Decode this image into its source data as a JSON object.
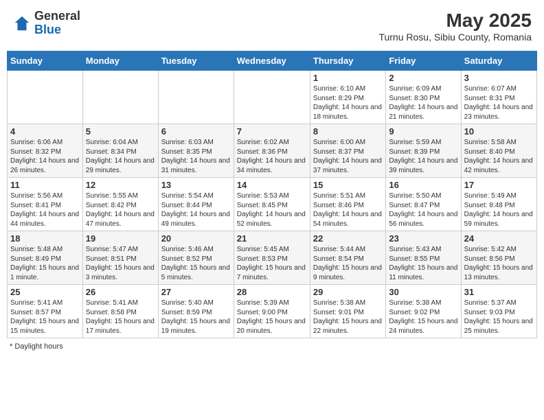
{
  "header": {
    "logo_general": "General",
    "logo_blue": "Blue",
    "title": "May 2025",
    "subtitle": "Turnu Rosu, Sibiu County, Romania"
  },
  "days_of_week": [
    "Sunday",
    "Monday",
    "Tuesday",
    "Wednesday",
    "Thursday",
    "Friday",
    "Saturday"
  ],
  "weeks": [
    [
      {
        "day": "",
        "info": ""
      },
      {
        "day": "",
        "info": ""
      },
      {
        "day": "",
        "info": ""
      },
      {
        "day": "",
        "info": ""
      },
      {
        "day": "1",
        "info": "Sunrise: 6:10 AM\nSunset: 8:29 PM\nDaylight: 14 hours and 18 minutes."
      },
      {
        "day": "2",
        "info": "Sunrise: 6:09 AM\nSunset: 8:30 PM\nDaylight: 14 hours and 21 minutes."
      },
      {
        "day": "3",
        "info": "Sunrise: 6:07 AM\nSunset: 8:31 PM\nDaylight: 14 hours and 23 minutes."
      }
    ],
    [
      {
        "day": "4",
        "info": "Sunrise: 6:06 AM\nSunset: 8:32 PM\nDaylight: 14 hours and 26 minutes."
      },
      {
        "day": "5",
        "info": "Sunrise: 6:04 AM\nSunset: 8:34 PM\nDaylight: 14 hours and 29 minutes."
      },
      {
        "day": "6",
        "info": "Sunrise: 6:03 AM\nSunset: 8:35 PM\nDaylight: 14 hours and 31 minutes."
      },
      {
        "day": "7",
        "info": "Sunrise: 6:02 AM\nSunset: 8:36 PM\nDaylight: 14 hours and 34 minutes."
      },
      {
        "day": "8",
        "info": "Sunrise: 6:00 AM\nSunset: 8:37 PM\nDaylight: 14 hours and 37 minutes."
      },
      {
        "day": "9",
        "info": "Sunrise: 5:59 AM\nSunset: 8:39 PM\nDaylight: 14 hours and 39 minutes."
      },
      {
        "day": "10",
        "info": "Sunrise: 5:58 AM\nSunset: 8:40 PM\nDaylight: 14 hours and 42 minutes."
      }
    ],
    [
      {
        "day": "11",
        "info": "Sunrise: 5:56 AM\nSunset: 8:41 PM\nDaylight: 14 hours and 44 minutes."
      },
      {
        "day": "12",
        "info": "Sunrise: 5:55 AM\nSunset: 8:42 PM\nDaylight: 14 hours and 47 minutes."
      },
      {
        "day": "13",
        "info": "Sunrise: 5:54 AM\nSunset: 8:44 PM\nDaylight: 14 hours and 49 minutes."
      },
      {
        "day": "14",
        "info": "Sunrise: 5:53 AM\nSunset: 8:45 PM\nDaylight: 14 hours and 52 minutes."
      },
      {
        "day": "15",
        "info": "Sunrise: 5:51 AM\nSunset: 8:46 PM\nDaylight: 14 hours and 54 minutes."
      },
      {
        "day": "16",
        "info": "Sunrise: 5:50 AM\nSunset: 8:47 PM\nDaylight: 14 hours and 56 minutes."
      },
      {
        "day": "17",
        "info": "Sunrise: 5:49 AM\nSunset: 8:48 PM\nDaylight: 14 hours and 59 minutes."
      }
    ],
    [
      {
        "day": "18",
        "info": "Sunrise: 5:48 AM\nSunset: 8:49 PM\nDaylight: 15 hours and 1 minute."
      },
      {
        "day": "19",
        "info": "Sunrise: 5:47 AM\nSunset: 8:51 PM\nDaylight: 15 hours and 3 minutes."
      },
      {
        "day": "20",
        "info": "Sunrise: 5:46 AM\nSunset: 8:52 PM\nDaylight: 15 hours and 5 minutes."
      },
      {
        "day": "21",
        "info": "Sunrise: 5:45 AM\nSunset: 8:53 PM\nDaylight: 15 hours and 7 minutes."
      },
      {
        "day": "22",
        "info": "Sunrise: 5:44 AM\nSunset: 8:54 PM\nDaylight: 15 hours and 9 minutes."
      },
      {
        "day": "23",
        "info": "Sunrise: 5:43 AM\nSunset: 8:55 PM\nDaylight: 15 hours and 11 minutes."
      },
      {
        "day": "24",
        "info": "Sunrise: 5:42 AM\nSunset: 8:56 PM\nDaylight: 15 hours and 13 minutes."
      }
    ],
    [
      {
        "day": "25",
        "info": "Sunrise: 5:41 AM\nSunset: 8:57 PM\nDaylight: 15 hours and 15 minutes."
      },
      {
        "day": "26",
        "info": "Sunrise: 5:41 AM\nSunset: 8:58 PM\nDaylight: 15 hours and 17 minutes."
      },
      {
        "day": "27",
        "info": "Sunrise: 5:40 AM\nSunset: 8:59 PM\nDaylight: 15 hours and 19 minutes."
      },
      {
        "day": "28",
        "info": "Sunrise: 5:39 AM\nSunset: 9:00 PM\nDaylight: 15 hours and 20 minutes."
      },
      {
        "day": "29",
        "info": "Sunrise: 5:38 AM\nSunset: 9:01 PM\nDaylight: 15 hours and 22 minutes."
      },
      {
        "day": "30",
        "info": "Sunrise: 5:38 AM\nSunset: 9:02 PM\nDaylight: 15 hours and 24 minutes."
      },
      {
        "day": "31",
        "info": "Sunrise: 5:37 AM\nSunset: 9:03 PM\nDaylight: 15 hours and 25 minutes."
      }
    ]
  ],
  "footer": "Daylight hours"
}
